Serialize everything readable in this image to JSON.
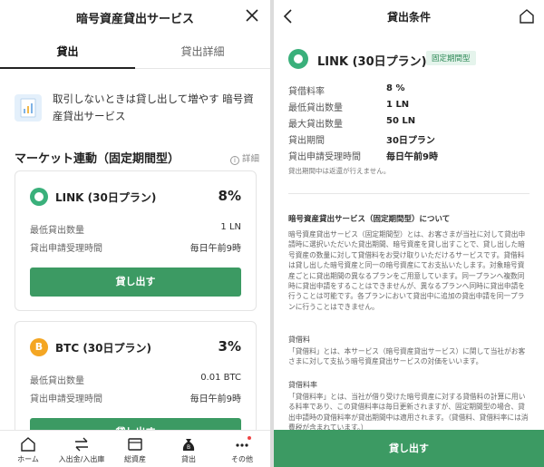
{
  "left": {
    "header_title": "暗号資産貸出サービス",
    "tabs": [
      {
        "label": "貸出",
        "active": true
      },
      {
        "label": "貸出詳細",
        "active": false
      }
    ],
    "intro_text": "取引しないときは貸し出して増やす 暗号資産貸出サービス",
    "section_title": "マーケット連動（固定期間型）",
    "section_detail": "詳細",
    "cards": [
      {
        "coin_icon": "link-icon",
        "plan": "LINK (30日プラン)",
        "rate": "8%",
        "min_label": "最低貸出数量",
        "min_value": "1 LN",
        "time_label": "貸出申請受理時間",
        "time_value": "毎日午前9時",
        "button": "貸し出す"
      },
      {
        "coin_icon": "btc-icon",
        "coin_symbol": "B",
        "plan": "BTC (30日プラン)",
        "rate": "3%",
        "min_label": "最低貸出数量",
        "min_value": "0.01 BTC",
        "time_label": "貸出申請受理時間",
        "time_value": "毎日午前9時",
        "button": "貸し出す"
      }
    ],
    "nav": [
      {
        "label": "ホーム",
        "icon": "home-icon"
      },
      {
        "label": "入出金/入出庫",
        "icon": "transfer-icon"
      },
      {
        "label": "総資産",
        "icon": "wallet-icon"
      },
      {
        "label": "貸出",
        "icon": "lending-bag-icon"
      },
      {
        "label": "その他",
        "icon": "more-icon"
      }
    ]
  },
  "right": {
    "header_title": "貸出条件",
    "product_name": "LINK (30日プラン)",
    "badge": "固定期間型",
    "conditions": [
      {
        "label": "貸借料率",
        "value": "8 %"
      },
      {
        "label": "最低貸出数量",
        "value": "1 LN"
      },
      {
        "label": "最大貸出数量",
        "value": "50 LN"
      },
      {
        "label": "貸出期間",
        "value": "30日プラン"
      },
      {
        "label": "貸出申請受理時間",
        "value": "毎日午前9時"
      }
    ],
    "note": "貸出期間中は返還が行えません。",
    "about_heading": "暗号資産貸出サービス（固定期間型）について",
    "about_body": "暗号資産貸出サービス（固定期間型）とは、お客さまが当社に対して貸出申請時に選択いただいた貸出期間、暗号資産を貸し出すことで、貸し出した暗号資産の数量に対して貸借料をお受け取りいただけるサービスです。貸借料は貸し出した暗号資産と同一の暗号資産にてお支払いたします。対象暗号資産ごとに貸出期間の異なるプランをご用意しています。同一プランへ複数同時に貸出申請をすることはできませんが、異なるプランへ同時に貸出申請を行うことは可能です。各プランにおいて貸出中に追加の貸出申請を同一プランに行うことはできません。",
    "fee_heading": "貸借料",
    "fee_body": "「貸借料」とは、本サービス（暗号資産貸出サービス）に関して当社がお客さまに対して支払う暗号資産貸出サービスの対価をいいます。",
    "rate_heading": "貸借料率",
    "rate_body": "「貸借料率」とは、当社が借り受けた暗号資産に対する貸借料の計算に用いる料率であり、この貸借料率は毎日更新されますが、固定期間型の場合、貸出申請時の貸借料率が貸出期間中は適用されます。（貸借料、貸借料率には消費税が含まれています。）",
    "bottom_button": "貸し出す"
  },
  "colors": {
    "accent_green": "#3c9a63",
    "link_coin": "#3ab07b",
    "btc_coin": "#f4a623",
    "badge_bg": "#e5f4ec",
    "badge_text": "#2f8a57"
  }
}
